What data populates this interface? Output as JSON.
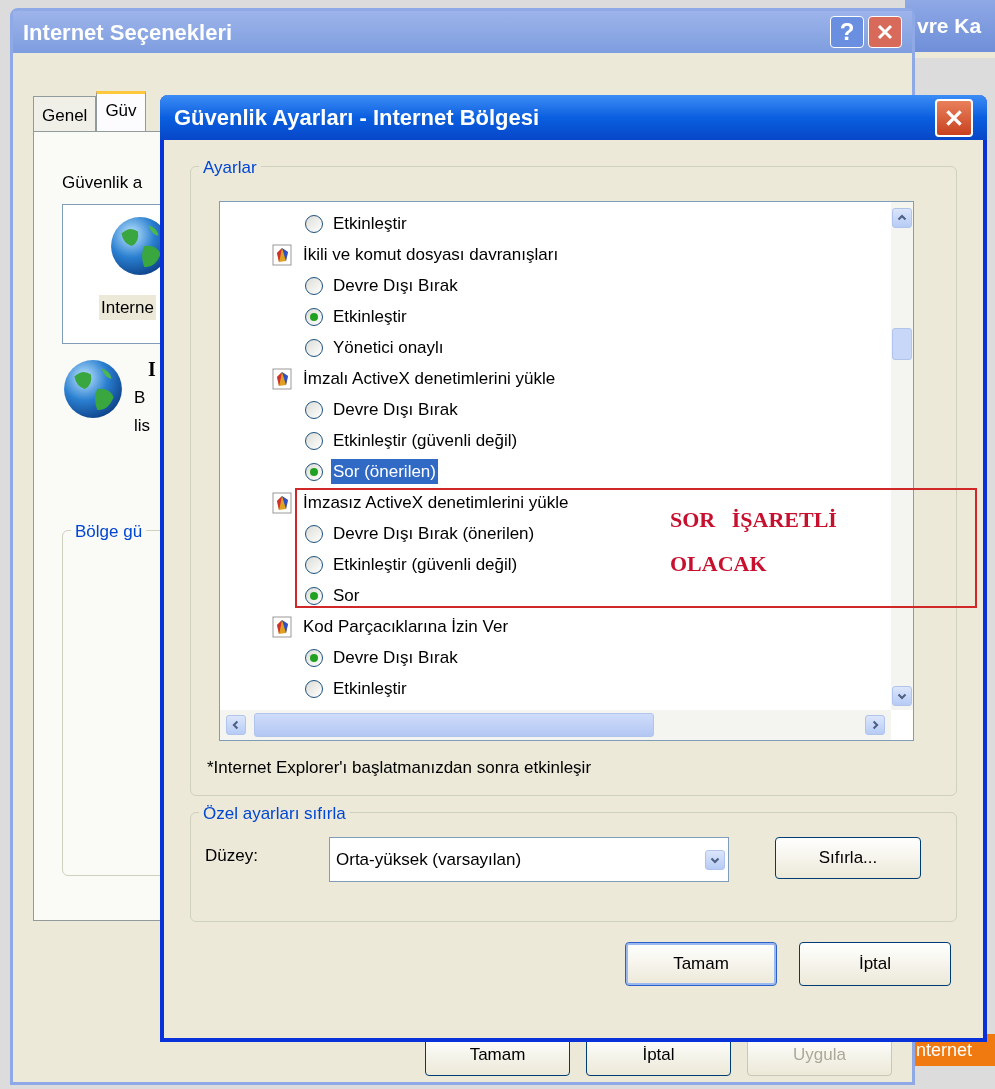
{
  "background_windows": [
    {
      "title": "vre Ka",
      "kind": "top"
    },
    {
      "title": "nternet",
      "kind": "bottom"
    }
  ],
  "options_window": {
    "title": "Internet Seçenekleri",
    "help": "?",
    "tabs": [
      {
        "label": "Genel",
        "selected": false
      },
      {
        "label": "Güv",
        "selected": true
      }
    ],
    "zone_label": "Güvenlik a",
    "zone_name": "Interne",
    "zone_heading": "I",
    "zone_text": [
      "B",
      "lis"
    ],
    "group_label": "Bölge gü",
    "buttons": [
      {
        "label": "Tamam",
        "disabled": false
      },
      {
        "label": "İptal",
        "disabled": false
      },
      {
        "label": "Uygula",
        "disabled": true
      }
    ]
  },
  "settings_dialog": {
    "title": "Güvenlik Ayarları - Internet Bölgesi",
    "settings_group": "Ayarlar",
    "items": [
      {
        "kind": "option",
        "label": "Etkinleştir",
        "checked": false,
        "selected": false
      },
      {
        "kind": "header",
        "label": "İkili ve komut dosyası davranışları",
        "selected": false
      },
      {
        "kind": "option",
        "label": "Devre Dışı Bırak",
        "checked": false,
        "selected": false
      },
      {
        "kind": "option",
        "label": "Etkinleştir",
        "checked": true,
        "selected": false
      },
      {
        "kind": "option",
        "label": "Yönetici onaylı",
        "checked": false,
        "selected": false
      },
      {
        "kind": "header",
        "label": "İmzalı ActiveX denetimlerini yükle",
        "selected": false
      },
      {
        "kind": "option",
        "label": "Devre Dışı Bırak",
        "checked": false,
        "selected": false
      },
      {
        "kind": "option",
        "label": "Etkinleştir (güvenli değil)",
        "checked": false,
        "selected": false
      },
      {
        "kind": "option",
        "label": "Sor (önerilen)",
        "checked": true,
        "selected": true
      },
      {
        "kind": "header",
        "label": "İmzasız ActiveX denetimlerini yükle",
        "selected": false
      },
      {
        "kind": "option",
        "label": "Devre Dışı Bırak (önerilen)",
        "checked": false,
        "selected": false
      },
      {
        "kind": "option",
        "label": "Etkinleştir (güvenli değil)",
        "checked": false,
        "selected": false
      },
      {
        "kind": "option",
        "label": "Sor",
        "checked": true,
        "selected": false
      },
      {
        "kind": "header",
        "label": "Kod Parçacıklarına İzin Ver",
        "selected": false
      },
      {
        "kind": "option",
        "label": "Devre Dışı Bırak",
        "checked": true,
        "selected": false
      },
      {
        "kind": "option",
        "label": "Etkinleştir",
        "checked": false,
        "selected": false
      }
    ],
    "note": "*Internet Explorer'ı başlatmanızdan sonra etkinleşir",
    "reset_group": "Özel ayarları sıfırla",
    "level_label": "Düzey:",
    "level_value": "Orta-yüksek (varsayılan)",
    "reset_button": "Sıfırla...",
    "buttons": [
      {
        "label": "Tamam",
        "default": true
      },
      {
        "label": "İptal",
        "default": false
      }
    ]
  },
  "annotation": {
    "lines": [
      "SOR   İŞARETLİ",
      "OLACAK"
    ]
  }
}
